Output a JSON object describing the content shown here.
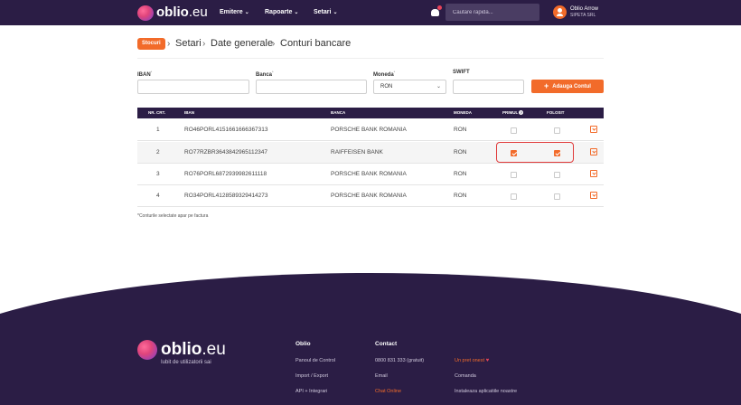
{
  "header": {
    "brand": "oblio",
    "brand_suffix": ".eu",
    "nav": [
      {
        "label": "Emitere"
      },
      {
        "label": "Rapoarte"
      },
      {
        "label": "Setari"
      }
    ],
    "search_placeholder": "Cautare rapida...",
    "user_name": "Oblio Arrow",
    "user_company": "SIPETA SRL"
  },
  "breadcrumb": {
    "badge": "Stocuri",
    "items": [
      "Setari",
      "Date generale",
      "Conturi bancare"
    ],
    "separator": "›"
  },
  "form": {
    "iban_label": "IBAN",
    "banca_label": "Banca",
    "moneda_label": "Moneda",
    "swift_label": "SWIFT",
    "required_mark": "*",
    "iban_value": "",
    "banca_value": "",
    "moneda_value": "RON",
    "swift_value": "",
    "add_button": "Adauga Contul"
  },
  "table": {
    "headers": {
      "nr": "NR. CRT.",
      "iban": "IBAN",
      "banca": "BANCA",
      "moneda": "MONEDA",
      "primul": "PRIMUL",
      "primul_info": "?",
      "folosit": "FOLOSIT"
    },
    "rows": [
      {
        "nr": "1",
        "iban": "RO46PORL4151661666367313",
        "banca": "PORSCHE BANK ROMANIA",
        "moneda": "RON",
        "primul": false,
        "folosit": false
      },
      {
        "nr": "2",
        "iban": "RO77RZBR3643842965112347",
        "banca": "RAIFFEISEN BANK",
        "moneda": "RON",
        "primul": true,
        "folosit": true
      },
      {
        "nr": "3",
        "iban": "RO76PORL6872939982611118",
        "banca": "PORSCHE BANK ROMANIA",
        "moneda": "RON",
        "primul": false,
        "folosit": false
      },
      {
        "nr": "4",
        "iban": "RO34PORL4128589329414273",
        "banca": "PORSCHE BANK ROMANIA",
        "moneda": "RON",
        "primul": false,
        "folosit": false
      }
    ],
    "note": "*Conturile selectate apar pe factura"
  },
  "footer": {
    "brand": "oblio",
    "brand_suffix": ".eu",
    "tagline": "Iubit de utilizatorii sai",
    "col1": {
      "title": "Oblio",
      "links": [
        "Panoul de Control",
        "Import / Export",
        "API + Integrari"
      ]
    },
    "col2": {
      "title": "Contact",
      "links": [
        "0800 831 333 (gratuit)",
        "Email",
        "Chat Online"
      ]
    },
    "col3": {
      "links": [
        "Un pret onest",
        "Comanda",
        "Instaleaza aplicatiile noastre"
      ]
    }
  },
  "colors": {
    "brand_dark": "#2b1d45",
    "accent": "#f26b2a",
    "highlight": "#e03a3a"
  }
}
